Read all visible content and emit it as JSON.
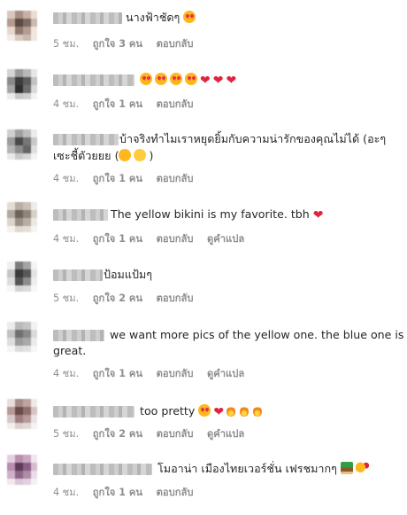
{
  "comments": [
    {
      "text": "นางฟ้าชัดๆ",
      "emoji": [
        "heart-eyes"
      ],
      "time": "5 ชม.",
      "likes": "ถูกใจ 3 คน",
      "reply": "ตอบกลับ"
    },
    {
      "text": "",
      "emoji": [
        "heart-eyes",
        "heart-eyes",
        "heart-eyes",
        "heart-eyes",
        "red-heart",
        "red-heart",
        "red-heart"
      ],
      "time": "4 ชม.",
      "likes": "ถูกใจ 1 คน",
      "reply": "ตอบกลับ"
    },
    {
      "text": "บ้าจริงทำไมเราหยุดยิ้มกับความน่ารักของคุณไม่ได้ (อะๆ",
      "text2": "เซะชี้ตัวยยย",
      "emoji": [
        "kissing",
        "smirk"
      ],
      "time": "4 ชม.",
      "likes": "ถูกใจ 1 คน",
      "reply": "ตอบกลับ"
    },
    {
      "text": "The yellow bikini is my favorite. tbh",
      "emoji": [
        "red-heart"
      ],
      "time": "4 ชม.",
      "likes": "ถูกใจ 1 คน",
      "reply": "ตอบกลับ",
      "translate": "ดูคำแปล"
    },
    {
      "text": "ป้อมแป้มๆ",
      "emoji": [],
      "time": "5 ชม.",
      "likes": "ถูกใจ 2 คน",
      "reply": "ตอบกลับ"
    },
    {
      "text": "we want more pics of the yellow one. the blue one is",
      "text2": "great.",
      "emoji": [],
      "time": "4 ชม.",
      "likes": "ถูกใจ 1 คน",
      "reply": "ตอบกลับ",
      "translate": "ดูคำแปล"
    },
    {
      "text": "too pretty",
      "emoji": [
        "heart-eyes",
        "red-heart",
        "fire",
        "fire",
        "fire"
      ],
      "time": "5 ชม.",
      "likes": "ถูกใจ 2 คน",
      "reply": "ตอบกลับ",
      "translate": "ดูคำแปล"
    },
    {
      "text": "โมอาน่า เมืองไทยเวอร์ชั่น เฟรชมากๆ",
      "emoji": [
        "desert-island",
        "smiling-face-with-hearts"
      ],
      "time": "4 ชม.",
      "likes": "ถูกใจ 1 คน",
      "reply": "ตอบกลับ"
    }
  ]
}
